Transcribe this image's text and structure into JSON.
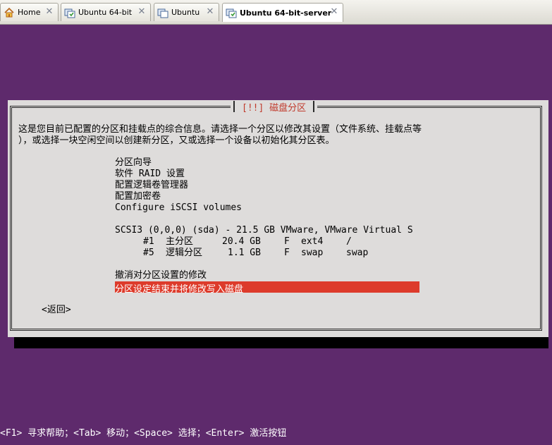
{
  "tabs": [
    {
      "label": "Home",
      "icon": "home-icon"
    },
    {
      "label": "Ubuntu 64-bit",
      "icon": "vm-icon"
    },
    {
      "label": "Ubuntu",
      "icon": "vm-icon"
    },
    {
      "label": "Ubuntu 64-bit-server",
      "icon": "vm-icon",
      "active": true
    }
  ],
  "dialog": {
    "title": "[!!] 磁盘分区",
    "description_line1": "这是您目前已配置的分区和挂载点的综合信息。请选择一个分区以修改其设置（文件系统、挂载点等",
    "description_line2": "），或选择一块空闲空间以创建新分区，又或选择一个设备以初始化其分区表。",
    "menu": {
      "guided": "分区向导",
      "raid": "软件 RAID 设置",
      "lvm": "配置逻辑卷管理器",
      "encrypted": "配置加密卷",
      "iscsi": "Configure iSCSI volumes"
    },
    "disk": {
      "header": "SCSI3 (0,0,0) (sda) - 21.5 GB VMware, VMware Virtual S",
      "partitions": [
        {
          "num": "#1",
          "type": "主分区",
          "size": "20.4 GB",
          "flag": "F",
          "fs": "ext4",
          "mount": "/"
        },
        {
          "num": "#5",
          "type": "逻辑分区",
          "size": "1.1 GB",
          "flag": "F",
          "fs": "swap",
          "mount": "swap"
        }
      ]
    },
    "undo": "撤消对分区设置的修改",
    "finish": "分区设定结束并将修改写入磁盘",
    "back": "<返回>"
  },
  "footer": "<F1> 寻求帮助；<Tab> 移动；<Space> 选择；<Enter> 激活按钮",
  "colors": {
    "background": "#5e2a6c",
    "dialog": "#dedcdb",
    "title": "#c0392b",
    "highlight": "#dd3b2b"
  }
}
